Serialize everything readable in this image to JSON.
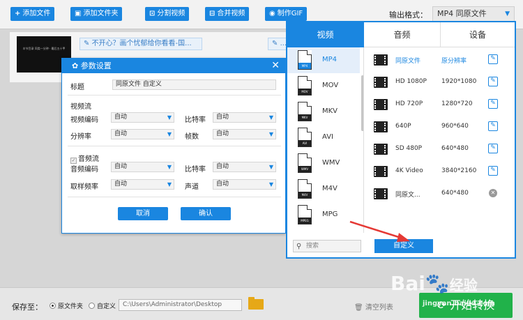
{
  "toolbar": {
    "buttons": [
      {
        "icon": "plus-icon",
        "label": "添加文件"
      },
      {
        "icon": "add-folder-icon",
        "label": "添加文件夹"
      },
      {
        "icon": "split-icon",
        "label": "分割视频"
      },
      {
        "icon": "merge-icon",
        "label": "合并视频"
      },
      {
        "icon": "gif-icon",
        "label": "制作GIF"
      }
    ],
    "output_format_label": "输出格式：",
    "output_format_value": "MP4  同原文件"
  },
  "file": {
    "thumb_text": "丰节目录 同类一分钟 · 最后五十甲",
    "title_edit": "不开心？画个忧郁给你看看-国...",
    "second_edit": "..."
  },
  "dialog": {
    "title": "参数设置",
    "title_label": "标题",
    "title_value": "同原文件 自定义",
    "video_section": "视频流",
    "video_codec_label": "视频编码",
    "video_codec_value": "自动",
    "video_bitrate_label": "比特率",
    "video_bitrate_value": "自动",
    "resolution_label": "分辨率",
    "resolution_value": "自动",
    "fps_label": "帧数",
    "fps_value": "自动",
    "audio_section": "音频流",
    "audio_codec_label": "音频编码",
    "audio_codec_value": "自动",
    "audio_bitrate_label": "比特率",
    "audio_bitrate_value": "自动",
    "sample_rate_label": "取样频率",
    "sample_rate_value": "自动",
    "channel_label": "声道",
    "channel_value": "自动",
    "cancel": "取消",
    "ok": "确认"
  },
  "panel": {
    "tabs": [
      "视频",
      "音频",
      "设备"
    ],
    "formats": [
      "MP4",
      "MOV",
      "MKV",
      "AVI",
      "WMV",
      "M4V",
      "MPG"
    ],
    "presets": [
      {
        "name": "同原文件",
        "res": "原分辨率",
        "action": "edit"
      },
      {
        "name": "HD 1080P",
        "res": "1920*1080",
        "action": "edit"
      },
      {
        "name": "HD 720P",
        "res": "1280*720",
        "action": "edit"
      },
      {
        "name": "640P",
        "res": "960*640",
        "action": "edit"
      },
      {
        "name": "SD 480P",
        "res": "640*480",
        "action": "edit"
      },
      {
        "name": "4K Video",
        "res": "3840*2160",
        "action": "edit"
      },
      {
        "name": "同原文...",
        "res": "640*480",
        "action": "delete"
      }
    ],
    "search_placeholder": "搜索",
    "custom_button": "自定义"
  },
  "bottom": {
    "save_to_label": "保存至：",
    "opt_source": "原文件夹",
    "opt_custom": "自定义",
    "path": "C:\\Users\\Administrator\\Desktop",
    "clear_list": "清空列表",
    "start": "开始转换"
  },
  "watermark": {
    "text1": "Bai",
    "text2": "经验",
    "text3": "jingyan.baidu.com"
  },
  "colors": {
    "accent": "#1a86e0",
    "start": "#21b24a",
    "arrow": "#e53935"
  }
}
